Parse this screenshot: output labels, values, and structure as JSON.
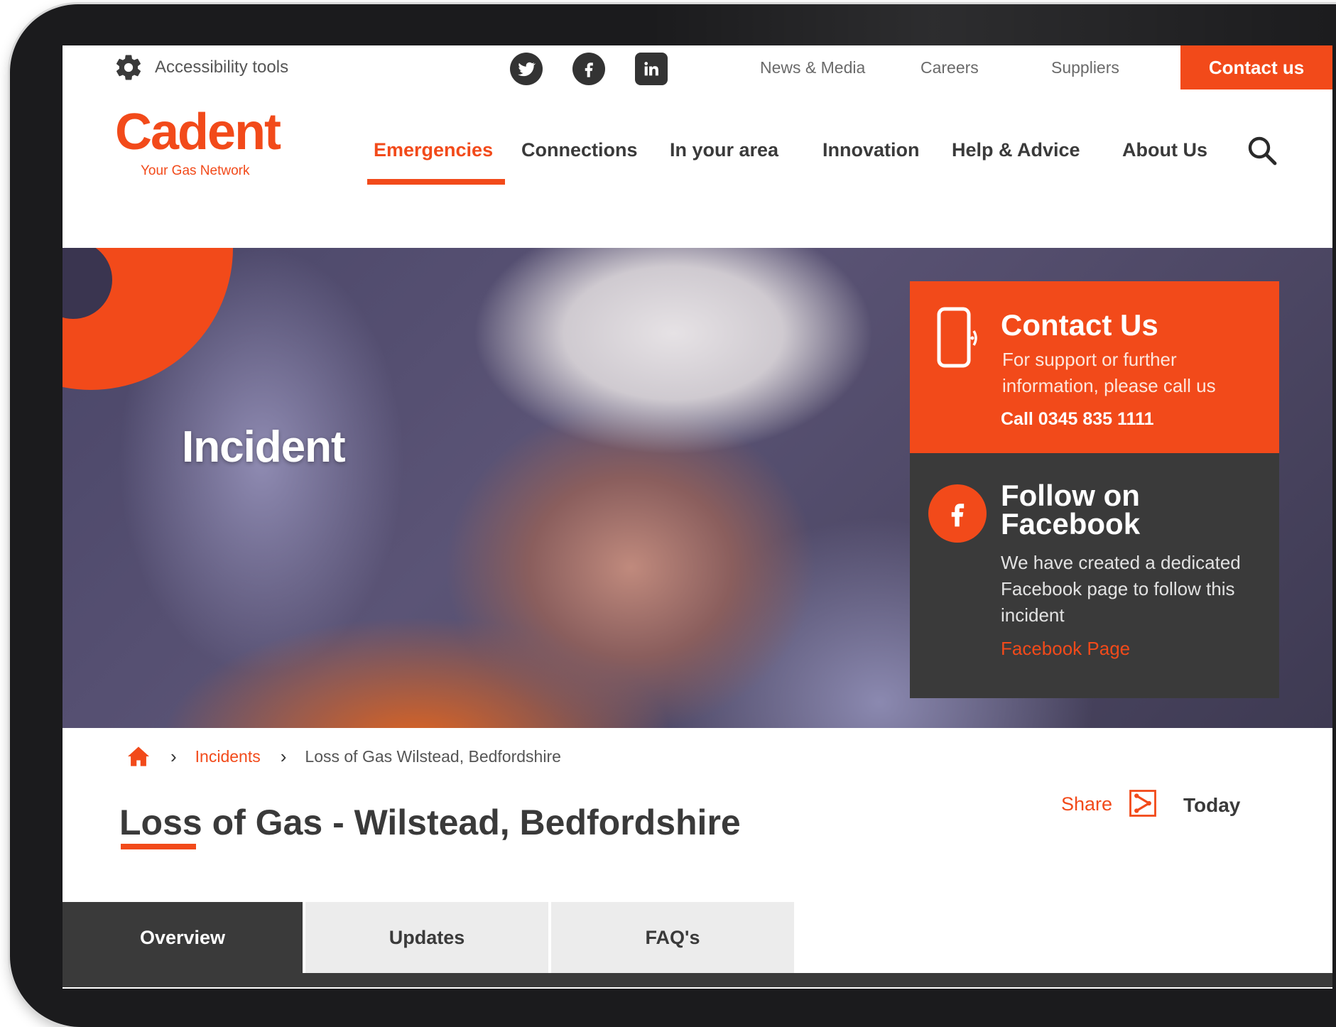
{
  "util_bar": {
    "accessibility_label": "Accessibility tools",
    "links": [
      "News & Media",
      "Careers",
      "Suppliers"
    ],
    "contact_label": "Contact us",
    "social_icons": [
      "twitter-icon",
      "facebook-icon",
      "linkedin-icon"
    ]
  },
  "logo": {
    "name": "Cadent",
    "tagline": "Your Gas Network"
  },
  "nav": {
    "items": [
      "Emergencies",
      "Connections",
      "In your area",
      "Innovation",
      "Help & Advice",
      "About Us"
    ],
    "active": "Emergencies"
  },
  "hero": {
    "title": "Incident",
    "contact": {
      "title": "Contact Us",
      "text": "For support or further information, please call us",
      "phone": "Call 0345 835 1111"
    },
    "facebook": {
      "title": "Follow on Facebook",
      "text": "We have created a dedicated Facebook page to follow this incident",
      "link": "Facebook Page"
    }
  },
  "breadcrumb": {
    "link": "Incidents",
    "current": "Loss of Gas Wilstead, Bedfordshire"
  },
  "page": {
    "title": "Loss of Gas - Wilstead, Bedfordshire",
    "share_label": "Share",
    "date": "Today"
  },
  "tabs": [
    {
      "label": "Overview",
      "active": true
    },
    {
      "label": "Updates",
      "active": false
    },
    {
      "label": "FAQ's",
      "active": false
    }
  ],
  "colors": {
    "accent": "#f24a1a",
    "dark": "#3a3a3a"
  }
}
